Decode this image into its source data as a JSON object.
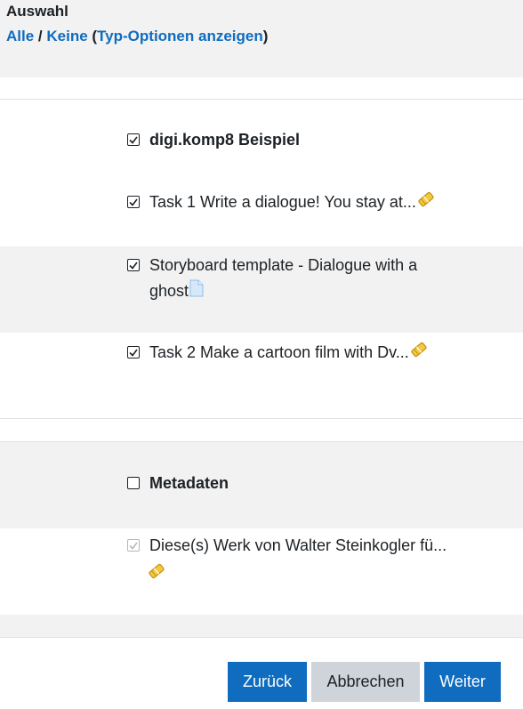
{
  "selection": {
    "title": "Auswahl",
    "all_label": "Alle",
    "separator": " / ",
    "none_label": "Keine",
    "open_paren": " (",
    "type_options_label": "Typ-Optionen anzeigen",
    "close_paren": ")"
  },
  "items": [
    {
      "label": "digi.komp8 Beispiel",
      "checked": true,
      "bold": true
    },
    {
      "label": "Task 1 Write a dialogue! You stay at...",
      "checked": true,
      "icon": "assignment-icon"
    },
    {
      "label_line1": "Storyboard template - Dialogue with a",
      "label_line2": "ghost",
      "checked": true,
      "icon": "file-icon"
    },
    {
      "label": "Task 2 Make a cartoon film with Dv...",
      "checked": true,
      "icon": "assignment-icon"
    },
    {
      "label": "Metadaten",
      "checked": false,
      "bold": true
    },
    {
      "label": "Diese(s) Werk von Walter Steinkogler fü...",
      "checked": true,
      "disabled": true,
      "icon": "assignment-icon"
    }
  ],
  "buttons": {
    "back": "Zurück",
    "cancel": "Abbrechen",
    "next": "Weiter"
  },
  "colors": {
    "link": "#0f6cbf",
    "primary_button": "#0f6cbf",
    "secondary_button": "#ced4da",
    "band": "#f2f2f2"
  }
}
